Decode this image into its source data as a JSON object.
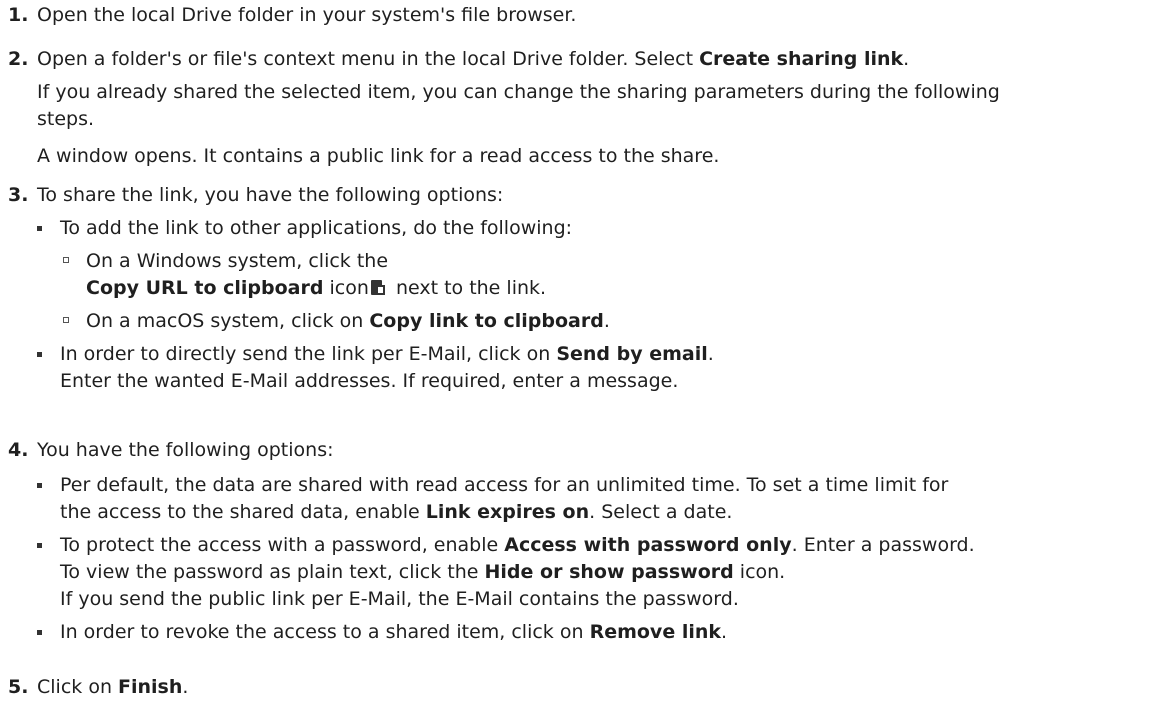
{
  "steps": [
    {
      "num": "1.",
      "text": "Open the local Drive folder in your system's file browser."
    },
    {
      "num": "2.",
      "a": "Open a folder's or file's context menu in the local Drive folder. Select ",
      "b": "Create sharing link",
      "c": ".",
      "p1a": "If you already shared the selected item, you can change the sharing parameters during the following",
      "p1b": "steps.",
      "p2": "A window opens. It contains a public link for a read access to the share."
    },
    {
      "num": "3.",
      "text": "To share the link, you have the following options:",
      "bullet1": "To add the link to other applications, do the following:",
      "sub1a": "On a Windows system, click the",
      "sub1b": "Copy URL to clipboard",
      "sub1c": " icon",
      "sub1d": " next to the link.",
      "sub2a": "On a macOS system, click on ",
      "sub2b": "Copy link to clipboard",
      "sub2c": ".",
      "bullet2a": "In order to directly send the link per E-Mail, click on ",
      "bullet2b": "Send by email",
      "bullet2c": ".",
      "bullet2d": "Enter the wanted E-Mail addresses. If required, enter a message."
    },
    {
      "num": "4.",
      "text": "You have the following options:",
      "b1a": "Per default, the data are shared with read access for an unlimited time. To set a time limit for",
      "b1b": "the access to the shared data, enable ",
      "b1c": "Link expires on",
      "b1d": ". Select a date.",
      "b2a": "To protect the access with a password, enable ",
      "b2b": "Access with password only",
      "b2c": ". Enter a password.",
      "b2d": "To view the password as plain text, click the ",
      "b2e": "Hide or show password",
      "b2f": " icon.",
      "b2g": "If you send the public link per E-Mail, the E-Mail contains the password.",
      "b3a": "In order to revoke the access to a shared item, click on ",
      "b3b": "Remove link",
      "b3c": "."
    },
    {
      "num": "5.",
      "a": "Click on ",
      "b": "Finish",
      "c": "."
    }
  ],
  "icons": {
    "clipboard": "clipboard-icon"
  }
}
